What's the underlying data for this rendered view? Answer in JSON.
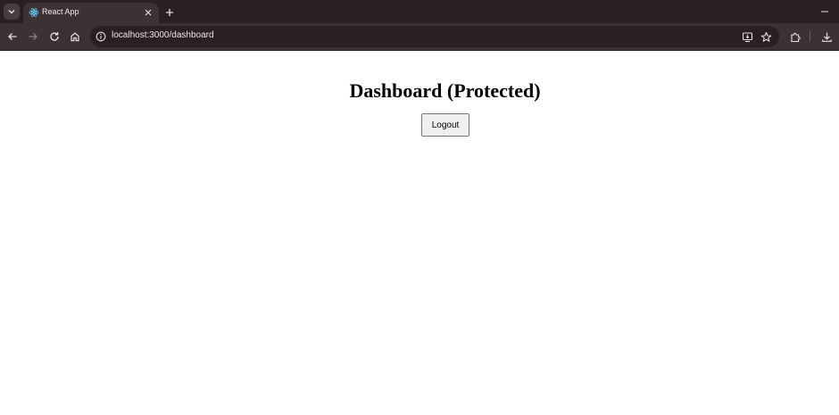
{
  "browser": {
    "tab": {
      "title": "React App"
    },
    "address_bar": {
      "url": "localhost:3000/dashboard"
    }
  },
  "page": {
    "title": "Dashboard (Protected)",
    "logout_label": "Logout"
  },
  "colors": {
    "frame": "#2a1f21",
    "toolbar": "#3e3134",
    "react_logo": "#61dafb"
  }
}
